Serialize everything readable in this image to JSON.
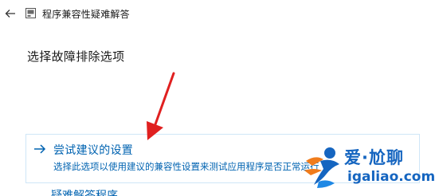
{
  "window": {
    "title": "程序兼容性疑难解答",
    "back_icon": "back-arrow-icon",
    "app_icon": "compatibility-troubleshooter-icon"
  },
  "main": {
    "heading": "选择故障排除选项",
    "options": [
      {
        "title": "尝试建议的设置",
        "description": "选择此选项以使用建议的兼容性设置来测试应用程序是否正常运行",
        "icon": "right-arrow-icon"
      },
      {
        "title": "疑难解答程序"
      }
    ]
  },
  "annotation": {
    "type": "red-pointer-arrow",
    "color": "#e02020"
  },
  "watermark": {
    "brand": "爱·尬聊",
    "domain": "igaliao.com",
    "color": "#1565c0"
  },
  "colors": {
    "link": "#0063b1",
    "option_border": "#cfe6f7"
  }
}
